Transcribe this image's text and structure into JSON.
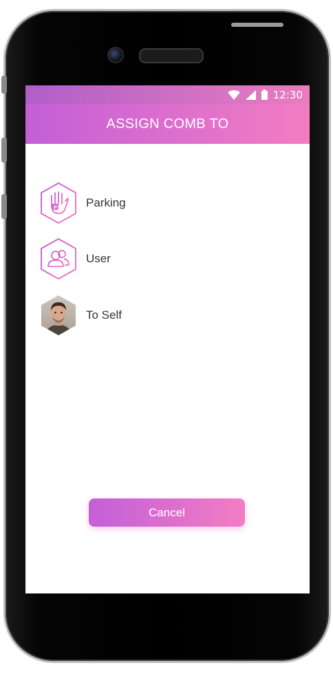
{
  "status_bar": {
    "time": "12:30",
    "icons": [
      "wifi-icon",
      "signal-icon",
      "battery-icon"
    ]
  },
  "app_bar": {
    "title": "ASSIGN COMB TO"
  },
  "options": [
    {
      "label": "Parking",
      "icon": "parking-hand-icon"
    },
    {
      "label": "User",
      "icon": "users-icon"
    },
    {
      "label": "To Self",
      "icon": "self-avatar"
    }
  ],
  "cancel_label": "Cancel",
  "colors": {
    "gradient_start": "#c35fd8",
    "gradient_end": "#f37dc3",
    "text": "#333333"
  }
}
